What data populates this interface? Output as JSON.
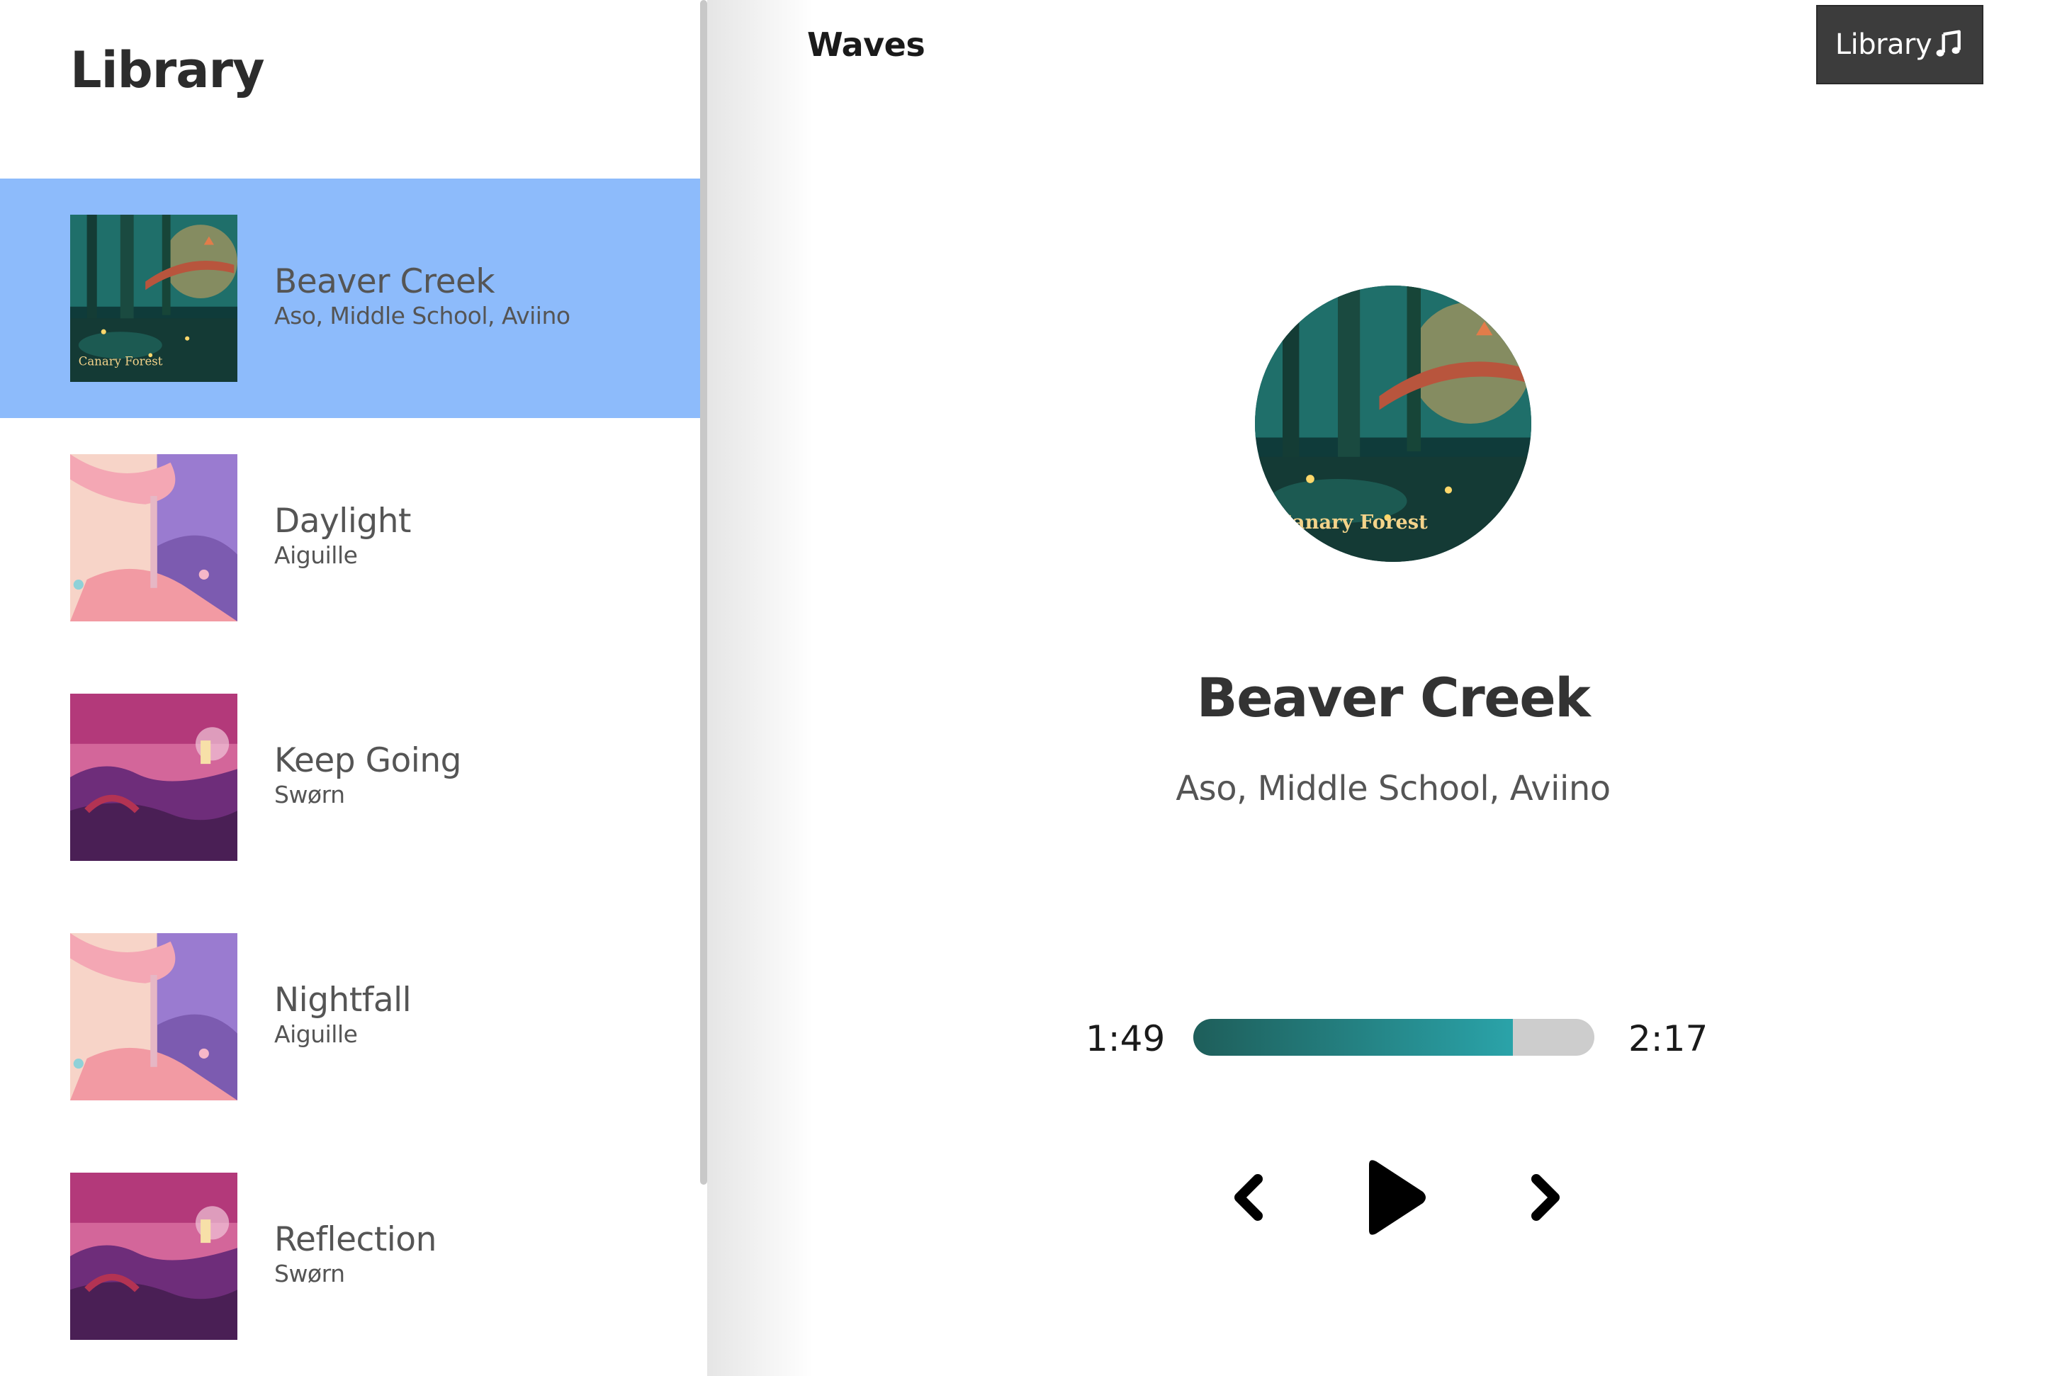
{
  "app": {
    "title": "Waves"
  },
  "header": {
    "library_button_label": "Library",
    "library_button_icon": "music-note-icon"
  },
  "library": {
    "title": "Library",
    "songs": [
      {
        "name": "Beaver Creek",
        "artist": "Aso, Middle School, Aviino",
        "selected": true,
        "cover_text": "Canary Forest"
      },
      {
        "name": "Daylight",
        "artist": "Aiguille",
        "selected": false
      },
      {
        "name": "Keep Going",
        "artist": "Swørn",
        "selected": false
      },
      {
        "name": "Nightfall",
        "artist": "Aiguille",
        "selected": false
      },
      {
        "name": "Reflection",
        "artist": "Swørn",
        "selected": false
      }
    ]
  },
  "player": {
    "song_name": "Beaver Creek",
    "song_artist": "Aso, Middle School, Aviino",
    "cover_text": "Canary Forest",
    "current_time": "1:49",
    "total_time": "2:17",
    "progress_fraction": 0.796,
    "controls": {
      "prev_icon": "chevron-left-icon",
      "play_icon": "play-icon",
      "next_icon": "chevron-right-icon"
    }
  },
  "colors": {
    "selected_row": "#8dbbfb",
    "progress_start": "#1e5e5a",
    "progress_end": "#2aa3a9",
    "progress_track": "#cdcdcd",
    "library_button_bg": "#3c3c3c"
  }
}
